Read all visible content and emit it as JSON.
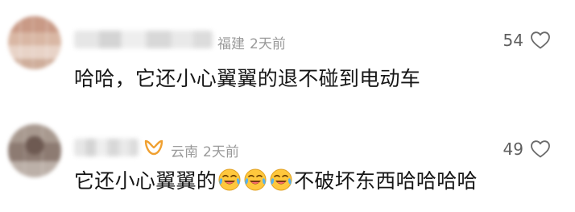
{
  "comments": [
    {
      "location": "福建",
      "time": "2天前",
      "likes": "54",
      "text": "哈哈，它还小心翼翼的退不碰到电动车",
      "avatar_icon": "blurred-avatar",
      "like_icon": "heart-outline-icon"
    },
    {
      "location": "云南",
      "time": "2天前",
      "likes": "49",
      "text_before": "它还小心翼翼的",
      "emoji_icon": "laughing-crying-emoji",
      "emoji_count": 3,
      "text_after": "不破坏东西哈哈哈哈",
      "badge_icon": "orange-badge-icon",
      "badge_color": "#F0A030",
      "avatar_icon": "blurred-avatar",
      "like_icon": "heart-outline-icon"
    }
  ]
}
